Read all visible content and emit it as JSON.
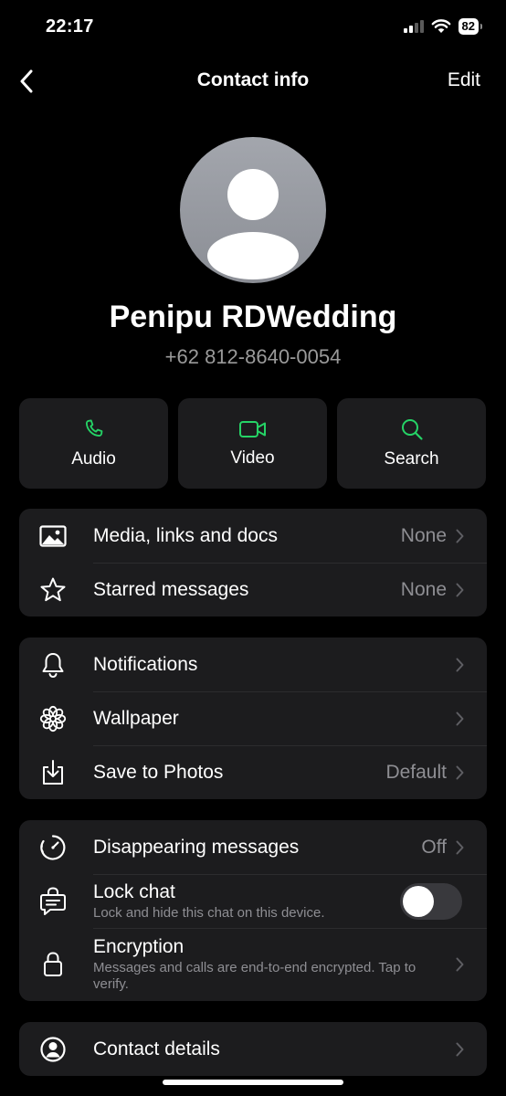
{
  "status": {
    "time": "22:17",
    "battery": "82"
  },
  "nav": {
    "title": "Contact info",
    "edit": "Edit"
  },
  "contact": {
    "name": "Penipu RDWedding",
    "phone": "+62 812-8640-0054"
  },
  "actions": [
    {
      "label": "Audio",
      "icon": "phone-icon"
    },
    {
      "label": "Video",
      "icon": "video-icon"
    },
    {
      "label": "Search",
      "icon": "search-icon"
    }
  ],
  "media_card": {
    "media": {
      "label": "Media, links and docs",
      "value": "None"
    },
    "starred": {
      "label": "Starred messages",
      "value": "None"
    }
  },
  "settings_card": {
    "notifications": {
      "label": "Notifications"
    },
    "wallpaper": {
      "label": "Wallpaper"
    },
    "save_photos": {
      "label": "Save to Photos",
      "value": "Default"
    }
  },
  "privacy_card": {
    "disappearing": {
      "label": "Disappearing messages",
      "value": "Off"
    },
    "lock": {
      "label": "Lock chat",
      "sub": "Lock and hide this chat on this device.",
      "enabled": false
    },
    "encryption": {
      "label": "Encryption",
      "sub": "Messages and calls are end-to-end encrypted. Tap to verify."
    }
  },
  "details_card": {
    "contact_details": {
      "label": "Contact details"
    }
  },
  "colors": {
    "accent": "#25d366",
    "background": "#000000",
    "card": "#1c1c1e",
    "secondary_text": "#8e8e93"
  }
}
